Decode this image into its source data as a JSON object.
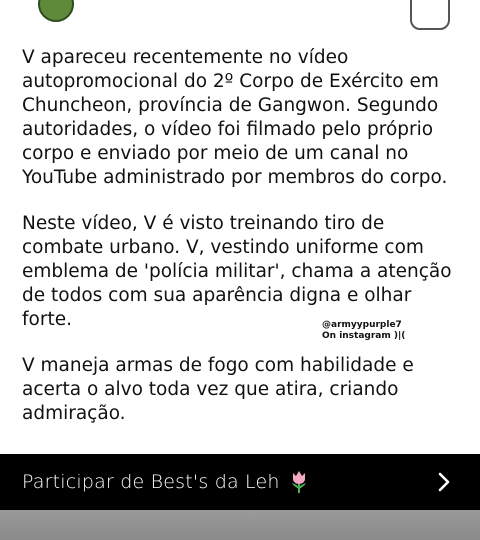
{
  "post": {
    "paragraphs": [
      "V apareceu recentemente no vídeo\nautopromocional do 2º Corpo de Exército em\nChuncheon, província de Gangwon. Segundo\nautoridades, o vídeo foi filmado pelo próprio\ncorpo e enviado por meio de um canal no\nYouTube administrado por membros do corpo.",
      "Neste vídeo, V é visto treinando tiro de\ncombate urbano. V, vestindo uniforme com\nemblema de 'polícia militar', chama a atenção\nde todos com sua aparência digna e olhar\nforte.",
      "V maneja armas de fogo com habilidade e\nacerta o alvo toda vez que atira, criando\nadmiração."
    ],
    "watermark_handle": "@armyypurple7",
    "watermark_note": "On instagram )|("
  },
  "cta": {
    "label": "Participar de Best's da Leh",
    "icon": "tulip-icon",
    "chevron": "chevron-right-icon"
  },
  "colors": {
    "text": "#111111",
    "cta_background": "#000000",
    "cta_text": "#ffffff",
    "tulip": "#f2a7c3"
  }
}
